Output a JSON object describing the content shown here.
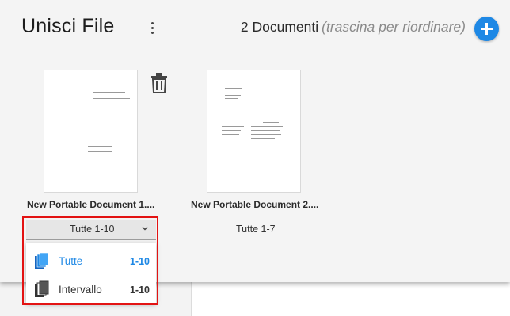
{
  "header": {
    "title": "Unisci File",
    "doc_count": "2 Documenti",
    "hint": "(trascina per riordinare)"
  },
  "documents": [
    {
      "name": "New Portable Document 1....",
      "range": "Tutte 1-10"
    },
    {
      "name": "New Portable Document 2....",
      "range": "Tutte 1-7"
    }
  ],
  "range_menu": {
    "items": [
      {
        "label": "Tutte",
        "range": "1-10",
        "selected": true
      },
      {
        "label": "Intervallo",
        "range": "1-10",
        "selected": false
      }
    ]
  },
  "icons": {
    "more": "more-vert-icon",
    "add": "add-circle-icon",
    "delete": "trash-icon",
    "dropdown": "chevron-down-icon",
    "all_pages": "stacked-pages-blue-icon",
    "interval": "stacked-pages-gray-icon"
  },
  "colors": {
    "accent": "#1e88e5",
    "highlight": "#e31313",
    "panel_bg": "#f4f4f4"
  }
}
